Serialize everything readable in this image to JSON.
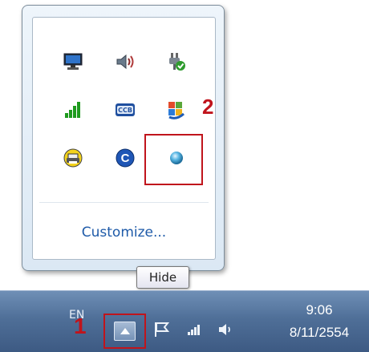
{
  "popup": {
    "icons": [
      {
        "name": "display-icon"
      },
      {
        "name": "volume-icon"
      },
      {
        "name": "power-plug-icon"
      },
      {
        "name": "signal-bars-icon"
      },
      {
        "name": "ccb-icon"
      },
      {
        "name": "windows-update-icon"
      },
      {
        "name": "printer-icon"
      },
      {
        "name": "c-app-icon"
      },
      {
        "name": "blue-dot-icon"
      }
    ],
    "customize_label": "Customize..."
  },
  "annotations": {
    "marker_1": "1",
    "marker_2": "2"
  },
  "tooltip": {
    "text": "Hide"
  },
  "taskbar": {
    "language": "EN",
    "time": "9:06",
    "date": "8/11/2554"
  },
  "colors": {
    "highlight": "#c0141c",
    "link": "#1e5aa8",
    "taskbar": "#4f6f98"
  }
}
